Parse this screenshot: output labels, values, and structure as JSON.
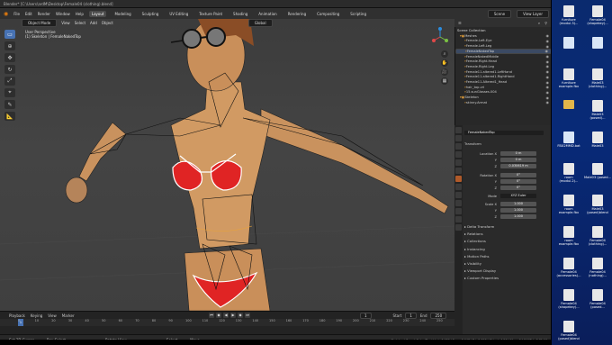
{
  "window": {
    "title": "Blender* [C:\\Users\\ardM\\Desktop\\Female04 (clothing).blend]"
  },
  "menu": [
    "File",
    "Edit",
    "Render",
    "Window",
    "Help"
  ],
  "workspaces": [
    "Layout",
    "Modeling",
    "Sculpting",
    "UV Editing",
    "Texture Paint",
    "Shading",
    "Animation",
    "Rendering",
    "Compositing",
    "Scripting"
  ],
  "header_right": {
    "scene_label": "Scene",
    "view_layer_label": "View Layer"
  },
  "viewport": {
    "mode": "Object Mode",
    "menus": [
      "View",
      "Select",
      "Add",
      "Object"
    ],
    "transform": "Global",
    "info_line1": "User Perspective",
    "info_line2": "(1) Skeleton | FemaleNakedTop"
  },
  "outliner": {
    "title": "Scene Collection",
    "rows": [
      {
        "label": "Meshes",
        "indent": 1
      },
      {
        "label": "Female.Left.Eye",
        "indent": 2
      },
      {
        "label": "Female.Left.Leg",
        "indent": 2
      },
      {
        "label": "FemaleNakedTop",
        "indent": 2,
        "selected": true
      },
      {
        "label": "FemaleNakedMiddle",
        "indent": 2
      },
      {
        "label": "Female.Right.Head",
        "indent": 2
      },
      {
        "label": "Female.Right.Leg",
        "indent": 2
      },
      {
        "label": "Female11.altered1.LeftHand",
        "indent": 2
      },
      {
        "label": "Female11.altered1.RightHand",
        "indent": 2
      },
      {
        "label": "Female11.Altered1_Head",
        "indent": 2
      },
      {
        "label": "hair_top.vrl",
        "indent": 2
      },
      {
        "label": "15.sunGlasses.004",
        "indent": 2
      },
      {
        "label": "Skeleton",
        "indent": 1
      },
      {
        "label": "skinny.Armat",
        "indent": 2
      }
    ]
  },
  "properties": {
    "object_name": "FemaleNakedTop",
    "transform_title": "Transform",
    "location_label": "Location X",
    "location": [
      "0 m",
      "0 m",
      "0.030619 m"
    ],
    "rotation_label": "Rotation X",
    "rotation": [
      "0°",
      "0°",
      "0°"
    ],
    "mode_label": "Mode",
    "mode_value": "XYZ Euler",
    "scale_label": "Scale X",
    "scale": [
      "1.000",
      "1.000",
      "1.000"
    ],
    "sections": [
      "Delta Transform",
      "Relations",
      "Collections",
      "Instancing",
      "Motion Paths",
      "Visibility",
      "Viewport Display",
      "Custom Properties"
    ]
  },
  "timeline": {
    "menus": [
      "Playback",
      "Keying",
      "View",
      "Marker"
    ],
    "current_frame": "1",
    "start_label": "Start",
    "start": "1",
    "end_label": "End",
    "end": "250",
    "ticks": [
      "0",
      "10",
      "20",
      "30",
      "40",
      "50",
      "60",
      "70",
      "80",
      "90",
      "100",
      "110",
      "120",
      "130",
      "140",
      "150",
      "160",
      "170",
      "180",
      "190",
      "200",
      "210",
      "220",
      "230",
      "240",
      "250"
    ]
  },
  "statusbar": {
    "items": [
      "Set 3D Cursor",
      "Box Select",
      "Rotate View",
      "Select",
      "Move"
    ],
    "stats": "Skeleton | FemaleNakedTop | Verts:2,930 | Faces:3,047 | Tris:5,817 | Objects:1/15 | Mem: 54.7 MiB | v2.81.16"
  },
  "desktop_icons": [
    {
      "label": "furniture (modul.3)...",
      "kind": "img"
    },
    {
      "label": "Female04 (shapekey)...",
      "kind": "img"
    },
    {
      "label": "",
      "kind": "doc"
    },
    {
      "label": "",
      "kind": "doc"
    },
    {
      "label": "furniture example.fbx",
      "kind": "img"
    },
    {
      "label": "Male03 (clothing)...",
      "kind": "img"
    },
    {
      "label": "",
      "kind": "folder"
    },
    {
      "label": "Male03 (posed)...",
      "kind": "img"
    },
    {
      "label": "FBX2MMD.bat",
      "kind": "doc"
    },
    {
      "label": "Male03",
      "kind": "img"
    },
    {
      "label": "room (modul.2)...",
      "kind": "img"
    },
    {
      "label": "Male03 (posed...",
      "kind": "img"
    },
    {
      "label": "room example.fbx",
      "kind": "img"
    },
    {
      "label": "Male03 (posed)blend",
      "kind": "img"
    },
    {
      "label": "room example.fbx",
      "kind": "img"
    },
    {
      "label": "Female04 (clothing)...",
      "kind": "img"
    },
    {
      "label": "Female04 (accessories)...",
      "kind": "img"
    },
    {
      "label": "Female04 (nothing)...",
      "kind": "img"
    },
    {
      "label": "Female04 (shapekey)...",
      "kind": "img"
    },
    {
      "label": "Female04 (posed...",
      "kind": "img"
    },
    {
      "label": "Female04 (posed)blend",
      "kind": "img"
    }
  ]
}
